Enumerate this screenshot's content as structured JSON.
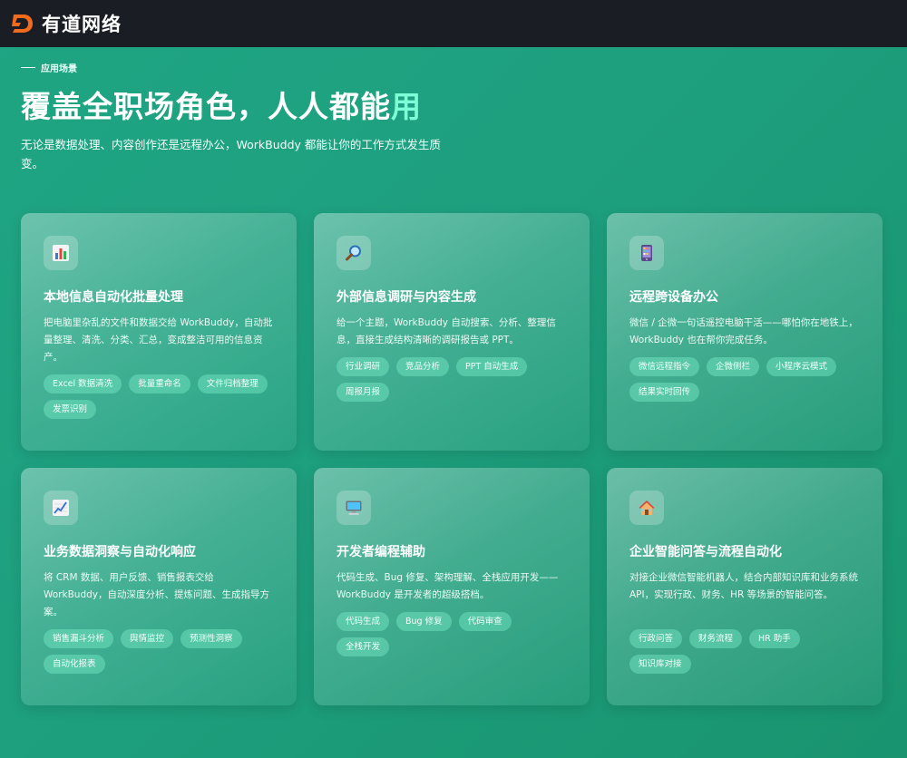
{
  "header": {
    "logo_icon": "d-logo-icon",
    "brand": "有道网络"
  },
  "hero": {
    "eyebrow": "应用场景",
    "headline_main": "覆盖全职场角色，人人都能",
    "headline_accent": "用",
    "subtitle": "无论是数据处理、内容创作还是远程办公，WorkBuddy 都能让你的工作方式发生质变。"
  },
  "colors": {
    "accent": "#7dffd8",
    "background": "#1fa583",
    "topbar": "#1b1d24",
    "logo": "#f26a1b"
  },
  "cards": [
    {
      "icon": "bar-chart-icon",
      "title": "本地信息自动化批量处理",
      "desc": "把电脑里杂乱的文件和数据交给 WorkBuddy，自动批量整理、清洗、分类、汇总，变成整洁可用的信息资产。",
      "tags": [
        "Excel 数据清洗",
        "批量重命名",
        "文件归档整理",
        "发票识别"
      ]
    },
    {
      "icon": "magnifier-icon",
      "title": "外部信息调研与内容生成",
      "desc": "给一个主题，WorkBuddy 自动搜索、分析、整理信息，直接生成结构清晰的调研报告或 PPT。",
      "tags": [
        "行业调研",
        "竞品分析",
        "PPT 自动生成",
        "周报月报"
      ]
    },
    {
      "icon": "mobile-phone-icon",
      "title": "远程跨设备办公",
      "desc": "微信 / 企微一句话遥控电脑干活——哪怕你在地铁上，WorkBuddy 也在帮你完成任务。",
      "tags": [
        "微信远程指令",
        "企微侧栏",
        "小程序云模式",
        "结果实时回传"
      ]
    },
    {
      "icon": "trend-chart-icon",
      "title": "业务数据洞察与自动化响应",
      "desc": "将 CRM 数据、用户反馈、销售报表交给 WorkBuddy，自动深度分析、提炼问题、生成指导方案。",
      "tags": [
        "销售漏斗分析",
        "舆情监控",
        "预测性洞察",
        "自动化报表"
      ]
    },
    {
      "icon": "monitor-icon",
      "title": "开发者编程辅助",
      "desc": "代码生成、Bug 修复、架构理解、全栈应用开发——WorkBuddy 是开发者的超级搭档。",
      "tags": [
        "代码生成",
        "Bug 修复",
        "代码审查",
        "全栈开发"
      ]
    },
    {
      "icon": "house-icon",
      "title": "企业智能问答与流程自动化",
      "desc": "对接企业微信智能机器人，结合内部知识库和业务系统 API，实现行政、财务、HR 等场景的智能问答。",
      "tags": [
        "行政问答",
        "财务流程",
        "HR 助手",
        "知识库对接"
      ]
    }
  ]
}
